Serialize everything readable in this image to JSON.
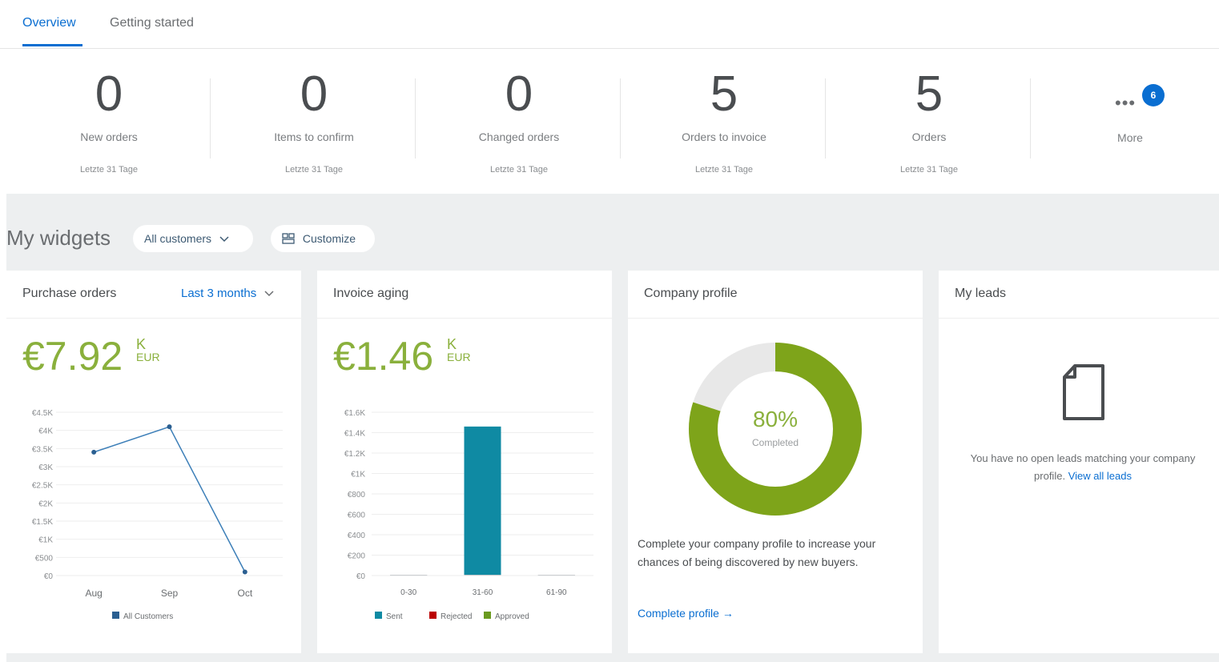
{
  "tabs": [
    {
      "label": "Overview"
    },
    {
      "label": "Getting started"
    }
  ],
  "tiles": [
    {
      "value": "0",
      "label": "New orders",
      "sub": "Letzte 31 Tage"
    },
    {
      "value": "0",
      "label": "Items to confirm",
      "sub": "Letzte 31 Tage"
    },
    {
      "value": "0",
      "label": "Changed orders",
      "sub": "Letzte 31 Tage"
    },
    {
      "value": "5",
      "label": "Orders to invoice",
      "sub": "Letzte 31 Tage"
    },
    {
      "value": "5",
      "label": "Orders",
      "sub": "Letzte 31 Tage"
    }
  ],
  "more": {
    "label": "More",
    "badge": "6",
    "icon": "more-dots-icon"
  },
  "widgets": {
    "title": "My widgets",
    "filter_label": "All customers",
    "customize_label": "Customize"
  },
  "purchase_orders": {
    "title": "Purchase orders",
    "period": "Last 3 months",
    "amount": "€7.92",
    "unit": "K",
    "currency": "EUR"
  },
  "invoice_aging": {
    "title": "Invoice aging",
    "amount": "€1.46",
    "unit": "K",
    "currency": "EUR"
  },
  "company_profile": {
    "title": "Company profile",
    "percent_label": "80%",
    "percent_value": 80,
    "completed_label": "Completed",
    "description": "Complete your company profile to increase your chances of being discovered by new buyers.",
    "link_label": "Complete profile →"
  },
  "my_leads": {
    "title": "My leads",
    "message": "You have no open leads matching your company profile.",
    "link_label": "View all leads"
  },
  "colors": {
    "accent": "#0a6ed1",
    "kpi": "#8ab03c",
    "sent": "#0f8aa3",
    "rejected": "#bb0000",
    "approved": "#6a9a1f",
    "donut_rest": "#e8e8e8"
  },
  "chart_data": [
    {
      "type": "line",
      "categories": [
        "Aug",
        "Sep",
        "Oct"
      ],
      "series": [
        {
          "name": "All Customers",
          "values": [
            3400,
            4100,
            100
          ]
        }
      ],
      "y_ticks": [
        "€4.5K",
        "€4K",
        "€3.5K",
        "€3K",
        "€2.5K",
        "€2K",
        "€1.5K",
        "€1K",
        "€500",
        "€0"
      ],
      "ylim": [
        0,
        4500
      ],
      "grid": true,
      "legend": "bottom"
    },
    {
      "type": "bar",
      "categories": [
        "0-30",
        "31-60",
        "61-90"
      ],
      "series": [
        {
          "name": "Sent",
          "values": [
            0,
            1460,
            0
          ]
        },
        {
          "name": "Rejected",
          "values": [
            0,
            0,
            0
          ]
        },
        {
          "name": "Approved",
          "values": [
            0,
            0,
            0
          ]
        }
      ],
      "y_ticks": [
        "€1.6K",
        "€1.4K",
        "€1.2K",
        "€1K",
        "€800",
        "€600",
        "€400",
        "€200",
        "€0"
      ],
      "ylim": [
        0,
        1600
      ],
      "grid": true,
      "legend": "bottom"
    }
  ]
}
